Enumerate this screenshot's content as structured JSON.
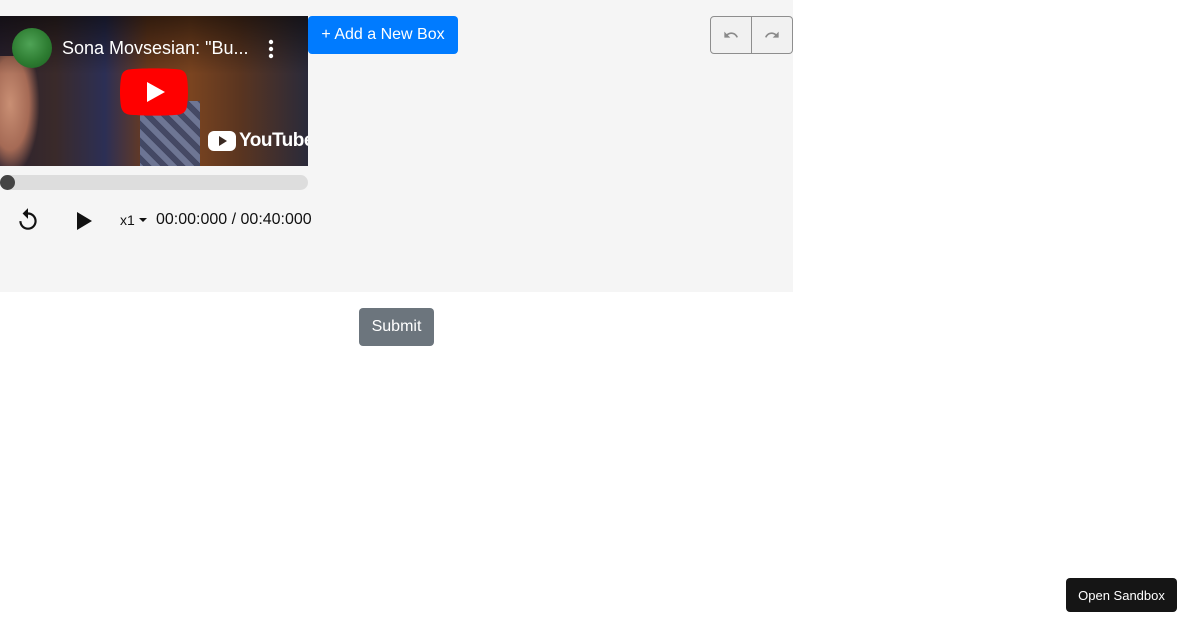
{
  "video": {
    "title": "Sona Movsesian: \"Bu...",
    "brand_text": "YouTube",
    "icons": {
      "avatar": "channel-avatar",
      "more": "more-vert-icon",
      "play": "youtube-play-icon",
      "logo": "youtube-logo-icon"
    }
  },
  "player": {
    "progress": 0,
    "speed": "x1",
    "time": "00:00:000 / 00:40:000",
    "icons": {
      "replay": "replay-icon",
      "play": "play-icon",
      "speed_caret": "caret-down-icon"
    }
  },
  "toolbar": {
    "add_box_label": "+ Add a New Box",
    "undo_icon": "undo-icon",
    "redo_icon": "redo-icon"
  },
  "form": {
    "submit_label": "Submit"
  },
  "footer": {
    "sandbox_label": "Open Sandbox"
  },
  "colors": {
    "primary": "#007bff",
    "secondary": "#6c757d",
    "youtube_red": "#ff0000",
    "workspace_bg": "#f5f5f5"
  }
}
